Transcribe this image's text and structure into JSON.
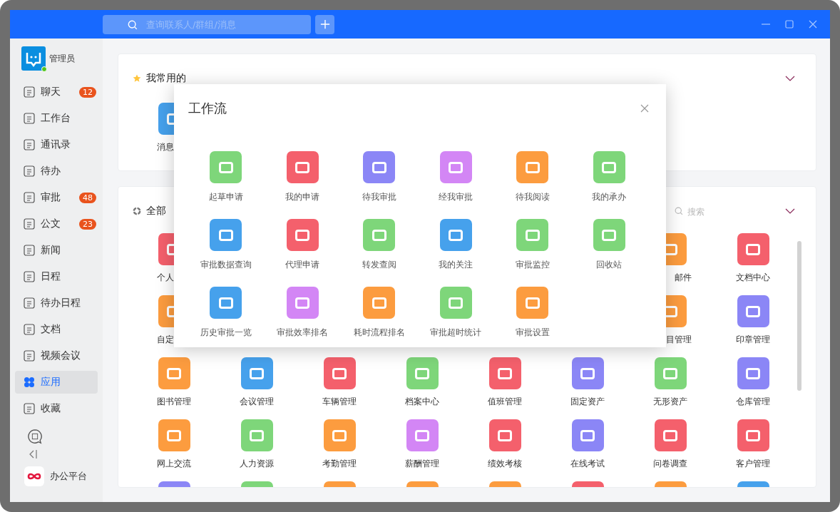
{
  "topbar": {
    "search": {
      "placeholder": "查询联系人/群组/消息"
    }
  },
  "sidebar": {
    "user": {
      "name": "管理员",
      "online": true
    },
    "items": [
      {
        "label": "聊天",
        "badge": "12",
        "selected": false
      },
      {
        "label": "工作台",
        "selected": false
      },
      {
        "label": "通讯录",
        "selected": false
      },
      {
        "label": "待办",
        "selected": false
      },
      {
        "label": "审批",
        "badge": "48",
        "selected": false
      },
      {
        "label": "公文",
        "badge": "23",
        "selected": false
      },
      {
        "label": "新闻",
        "selected": false
      },
      {
        "label": "日程",
        "selected": false
      },
      {
        "label": "待办日程",
        "selected": false
      },
      {
        "label": "文档",
        "selected": false
      },
      {
        "label": "视频会议",
        "selected": false
      },
      {
        "label": "应用",
        "selected": true
      },
      {
        "label": "收藏",
        "selected": false
      }
    ],
    "platform": "办公平台"
  },
  "favorites": {
    "title": "我常用的",
    "items": [
      {
        "kind": "cut_end",
        "label": "消息",
        "color": "#46a1ec"
      }
    ]
  },
  "all_apps": {
    "title": "全部",
    "search": {
      "placeholder": "搜索"
    },
    "items": [
      {
        "kind": "cut_end",
        "label": "个人",
        "color": "#f4606c"
      },
      {
        "kind": "covered"
      },
      {
        "kind": "covered"
      },
      {
        "kind": "covered"
      },
      {
        "kind": "covered"
      },
      {
        "kind": "covered"
      },
      {
        "kind": "cut_start",
        "label": "邮件",
        "color": "#fc9c3f"
      },
      {
        "label": "文档中心",
        "color": "#f4606c"
      },
      {
        "kind": "cut_end",
        "label": "自定",
        "color": "#fc9c3f"
      },
      {
        "kind": "covered"
      },
      {
        "kind": "covered"
      },
      {
        "kind": "covered"
      },
      {
        "kind": "covered"
      },
      {
        "kind": "covered"
      },
      {
        "kind": "cut_start",
        "label": "目管理",
        "color": "#fc9c3f"
      },
      {
        "label": "印章管理",
        "color": "#8b86f6"
      },
      {
        "label": "图书管理",
        "color": "#fc9c3f"
      },
      {
        "label": "会议管理",
        "color": "#46a1ec"
      },
      {
        "label": "车辆管理",
        "color": "#f4606c"
      },
      {
        "label": "档案中心",
        "color": "#7ed67a"
      },
      {
        "label": "值班管理",
        "color": "#f4606c"
      },
      {
        "label": "固定资产",
        "color": "#8b86f6"
      },
      {
        "label": "无形资产",
        "color": "#7ed67a"
      },
      {
        "label": "仓库管理",
        "color": "#8b86f6"
      },
      {
        "label": "网上交流",
        "color": "#fc9c3f"
      },
      {
        "label": "人力资源",
        "color": "#7ed67a"
      },
      {
        "label": "考勤管理",
        "color": "#fc9c3f"
      },
      {
        "label": "薪酬管理",
        "color": "#d386f5"
      },
      {
        "label": "绩效考核",
        "color": "#f4606c"
      },
      {
        "label": "在线考试",
        "color": "#8b86f6"
      },
      {
        "label": "问卷调查",
        "color": "#f4606c"
      },
      {
        "label": "客户管理",
        "color": "#f4606c"
      },
      {
        "color": "#8b86f6"
      },
      {
        "color": "#7ed67a"
      },
      {
        "color": "#fc9c3f"
      },
      {
        "color": "#fc9c3f"
      },
      {
        "color": "#fc9c3f"
      },
      {
        "color": "#f4606c"
      },
      {
        "color": "#fc9c3f"
      },
      {
        "color": "#46a1ec"
      }
    ]
  },
  "workflow_dialog": {
    "title": "工作流",
    "items": [
      {
        "label": "起草申请",
        "color": "#7ed67a"
      },
      {
        "label": "我的申请",
        "color": "#f4606c"
      },
      {
        "label": "待我审批",
        "color": "#8b86f6"
      },
      {
        "label": "经我审批",
        "color": "#d386f5"
      },
      {
        "label": "待我阅读",
        "color": "#fc9c3f"
      },
      {
        "label": "我的承办",
        "color": "#7ed67a"
      },
      {
        "label": "审批数据查询",
        "color": "#46a1ec"
      },
      {
        "label": "代理申请",
        "color": "#f4606c"
      },
      {
        "label": "转发查阅",
        "color": "#7ed67a"
      },
      {
        "label": "我的关注",
        "color": "#46a1ec"
      },
      {
        "label": "审批监控",
        "color": "#7ed67a"
      },
      {
        "label": "回收站",
        "color": "#7ed67a"
      },
      {
        "label": "历史审批一览",
        "color": "#46a1ec"
      },
      {
        "label": "审批效率排名",
        "color": "#d386f5"
      },
      {
        "label": "耗时流程排名",
        "color": "#fc9c3f"
      },
      {
        "label": "审批超时统计",
        "color": "#7ed67a"
      },
      {
        "label": "审批设置",
        "color": "#fc9c3f"
      }
    ]
  }
}
